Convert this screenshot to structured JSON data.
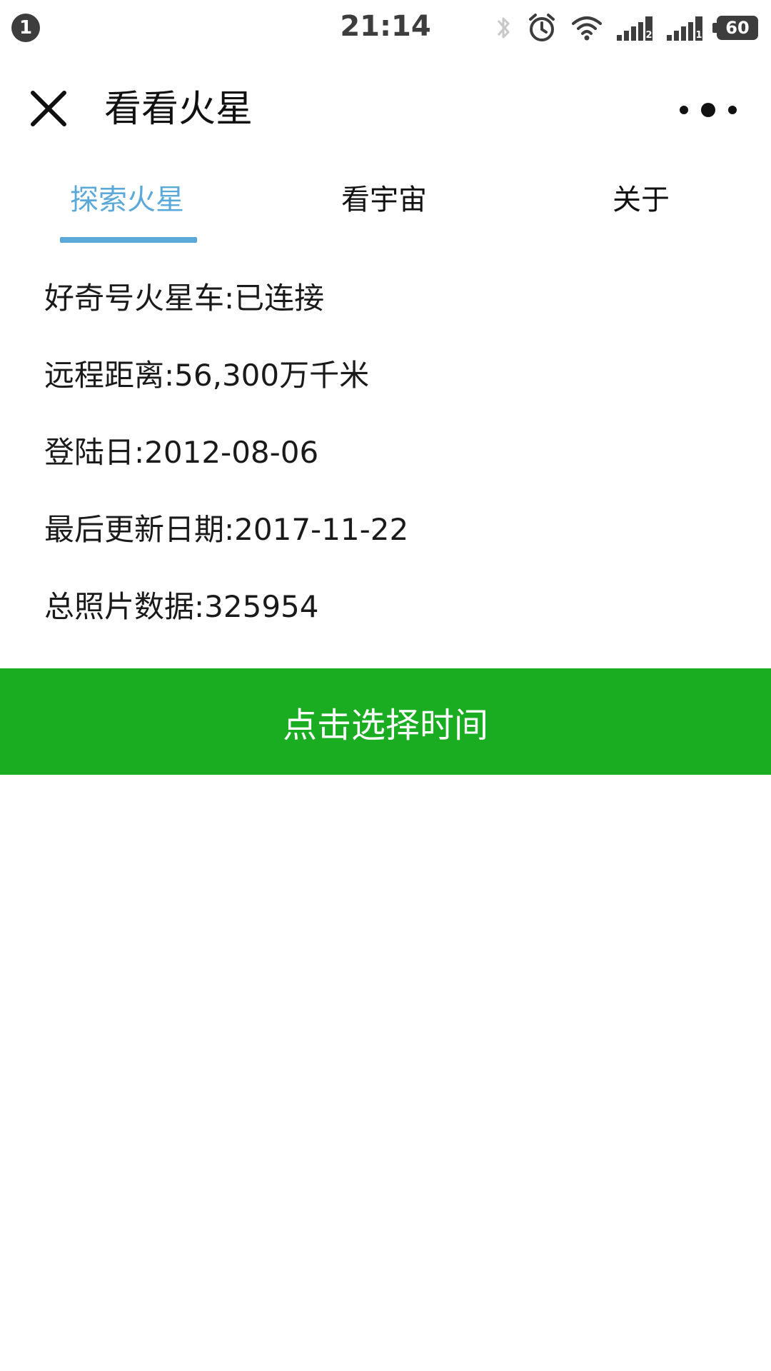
{
  "status_bar": {
    "notification_count": "1",
    "time": "21:14",
    "battery": "60",
    "icons": [
      "bluetooth-icon",
      "alarm-icon",
      "wifi-icon",
      "signal-icon",
      "signal-icon",
      "battery-icon"
    ],
    "sim_labels": [
      "2",
      "1"
    ]
  },
  "nav": {
    "title": "看看火星",
    "close_icon": "close-icon",
    "more_icon": "more-dots-icon"
  },
  "tabs": [
    {
      "label": "探索火星",
      "active": true
    },
    {
      "label": "看宇宙",
      "active": false
    },
    {
      "label": "关于",
      "active": false
    }
  ],
  "info": {
    "rover_status": "好奇号火星车:已连接",
    "distance": "远程距离:56,300万千米",
    "landing_date": "登陆日:2012-08-06",
    "last_update": "最后更新日期:2017-11-22",
    "total_photos": "总照片数据:325954"
  },
  "actions": {
    "select_time_label": "点击选择时间"
  },
  "colors": {
    "accent": "#5aa9d9",
    "button": "#1aad22",
    "text": "#1a1a1a"
  }
}
